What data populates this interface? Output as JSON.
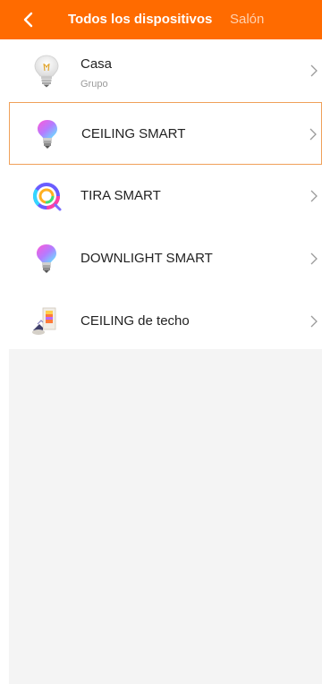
{
  "header": {
    "back_icon": "chevron-left-icon",
    "tab_active": "Todos los dispositivos",
    "tab_inactive": "Salón",
    "accent_color": "#ff6b00"
  },
  "devices": [
    {
      "name": "Casa",
      "subtitle": "Grupo",
      "icon": "group-bulb-icon"
    },
    {
      "name": "CEILING SMART",
      "icon": "rgb-bulb-icon",
      "selected": true
    },
    {
      "name": "TIRA SMART",
      "icon": "led-strip-icon"
    },
    {
      "name": "DOWNLIGHT SMART",
      "icon": "rgb-bulb-icon"
    },
    {
      "name": "CEILING de techo",
      "icon": "ceiling-lamp-icon"
    }
  ]
}
